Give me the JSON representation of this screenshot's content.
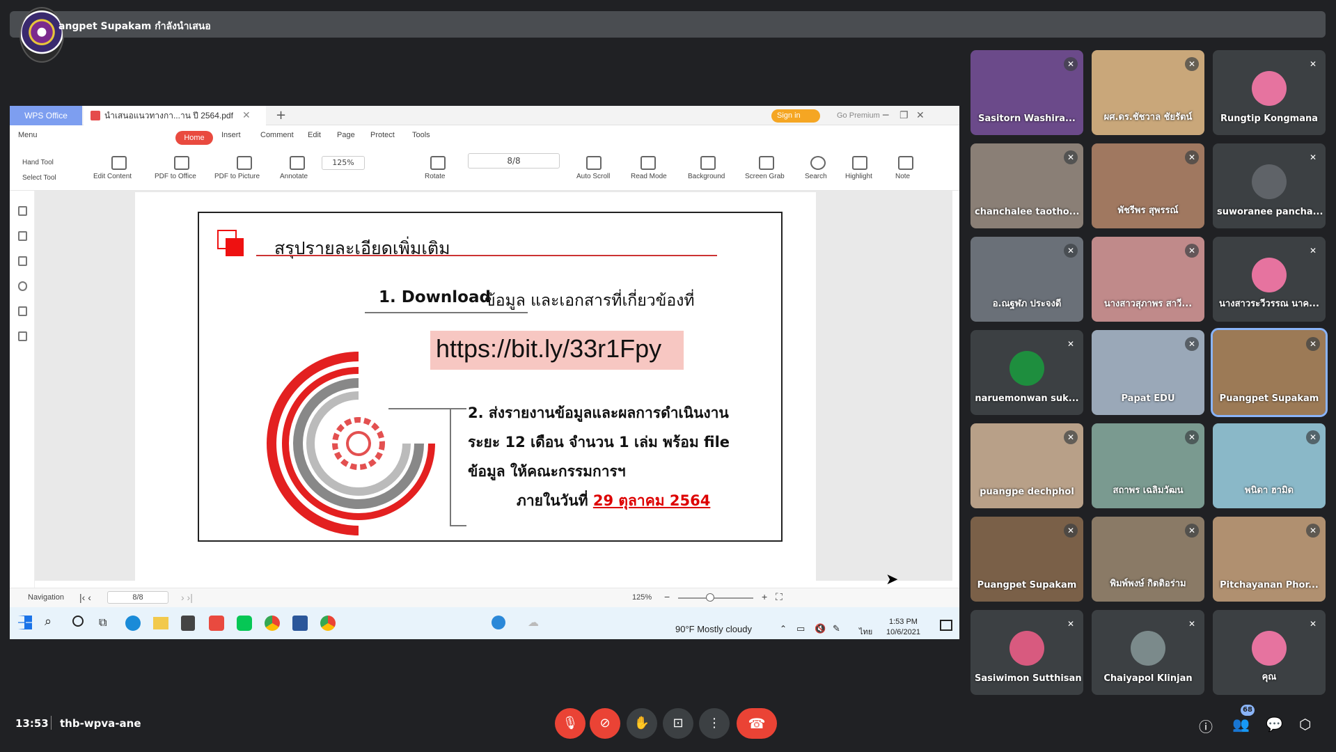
{
  "presenter": {
    "name": "angpet Supakam กำลังนำเสนอ"
  },
  "wps": {
    "app_tab": "WPS Office",
    "doc_tab": "นำเสนอแนวทางกา...าน ปี 2564.pdf",
    "sign_in": "Sign in",
    "go_premium": "Go Premium",
    "menu": [
      "Menu",
      "Home",
      "Insert",
      "Comment",
      "Edit",
      "Page",
      "Protect",
      "Tools"
    ],
    "tools": [
      "Hand Tool",
      "Select Tool",
      "Edit Content",
      "PDF to Office",
      "PDF to Picture",
      "Annotate",
      "Rotate",
      "Auto Scroll",
      "Read Mode",
      "Background",
      "Screen Grab",
      "Search",
      "Highlight",
      "Note"
    ],
    "zoom": "125%",
    "page": "8/8",
    "status_navigation": "Navigation",
    "status_page": "8/8",
    "status_zoom": "125%"
  },
  "slide": {
    "title": "สรุปรายละเอียดเพิ่มเติม",
    "item1_bold": "1. Download",
    "item1_text": "ข้อมูล และเอกสารที่เกี่ยวข้องที่",
    "url": "https://bit.ly/33r1Fpy",
    "item2_line1": "2. ส่งรายงานข้อมูลและผลการดำเนินงาน",
    "item2_line2": "ระยะ 12 เดือน จำนวน 1 เล่ม พร้อม file",
    "item2_line3": "ข้อมูล ให้คณะกรรมการฯ",
    "item2_line4": "ภายในวันที่",
    "item2_date": "29 ตุลาคม 2564"
  },
  "taskbar": {
    "weather": "90°F  Mostly cloudy",
    "lang": "ไทย",
    "time": "1:53 PM",
    "date": "10/6/2021"
  },
  "participants": [
    {
      "name": "Sasitorn Washira...",
      "bg": "#6b4a8a"
    },
    {
      "name": "ผศ.ดร.ชัชวาล ชัยรัตน์",
      "bg": "#c9a77a"
    },
    {
      "name": "Rungtip Kongmana",
      "bg": "#3c4043"
    },
    {
      "name": "chanchalee taotho...",
      "bg": "#8a7f76"
    },
    {
      "name": "พัชรีพร สุพรรณ์",
      "bg": "#a07860"
    },
    {
      "name": "suworanee pancha...",
      "bg": "#3c4043"
    },
    {
      "name": "อ.ณฐฬภ ประจงดี",
      "bg": "#6a7078"
    },
    {
      "name": "นางสาวสุภาพร สาวี...",
      "bg": "#c08a8a"
    },
    {
      "name": "นางสาวระวีวรรณ นาค...",
      "bg": "#3c4043"
    },
    {
      "name": "naruemonwan suk...",
      "bg": "#3c4043"
    },
    {
      "name": "Papat EDU",
      "bg": "#9aa8b8"
    },
    {
      "name": "Puangpet Supakam",
      "bg": "#9c7a56"
    },
    {
      "name": "puangpe dechphol",
      "bg": "#b8a088"
    },
    {
      "name": "สถาพร เฉลิมวัฒน",
      "bg": "#7a9a90"
    },
    {
      "name": "พนิดา ฮามิด",
      "bg": "#8ab8c8"
    },
    {
      "name": "Puangpet Supakam",
      "bg": "#7a6048"
    },
    {
      "name": "พิมพ์พงษ์ กิตติอร่าม",
      "bg": "#8a7a66"
    },
    {
      "name": "Pitchayanan Phor...",
      "bg": "#b09070"
    },
    {
      "name": "Sasiwimon Sutthisan",
      "bg": "#3c4043"
    },
    {
      "name": "Chaiyapol Klinjan",
      "bg": "#3c4043"
    },
    {
      "name": "คุณ",
      "bg": "#3c4043"
    }
  ],
  "meeting": {
    "time": "13:53",
    "code": "thb-wpva-ane",
    "participant_count": "68"
  },
  "colors": {
    "accent_red": "#ea4335",
    "tile_bg": "#3c4043",
    "meet_bg": "#202124",
    "wps_home": "#e94a3f"
  },
  "icons": [
    "mic-off-icon",
    "camera-off-icon",
    "raise-hand-icon",
    "present-icon",
    "more-icon",
    "end-call-icon",
    "info-icon",
    "people-icon",
    "chat-icon",
    "activities-icon"
  ]
}
